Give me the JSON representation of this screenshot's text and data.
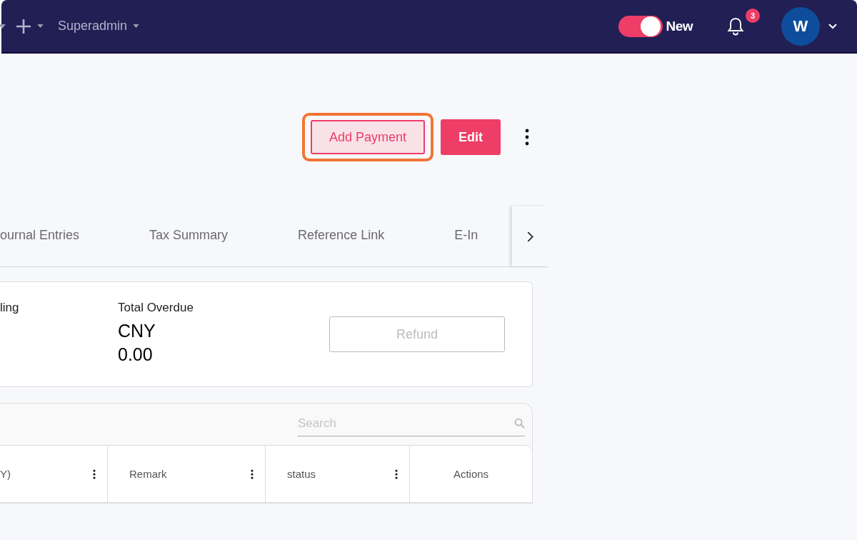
{
  "topbar": {
    "user_menu": {
      "label": "Superadmin"
    },
    "toggle": {
      "label": "New",
      "on": true
    },
    "notifications": {
      "count": "3"
    },
    "avatar": {
      "initial": "W"
    }
  },
  "actions": [
    {
      "label": "Add Payment",
      "kind": "secondary",
      "highlighted": true
    },
    {
      "label": "Edit",
      "kind": "primary",
      "highlighted": false
    }
  ],
  "tabs": [
    {
      "label": "ournal Entries",
      "selected": false
    },
    {
      "label": "Tax Summary",
      "selected": false
    },
    {
      "label": "Reference Link",
      "selected": false
    },
    {
      "label": "E-In",
      "selected": false
    }
  ],
  "summary": {
    "items": [
      {
        "label": "ling"
      },
      {
        "label": "Total Overdue",
        "currency": "CNY",
        "amount": "0.00"
      }
    ],
    "refund": {
      "label": "Refund",
      "disabled": true
    }
  },
  "table": {
    "search": {
      "placeholder": "Search"
    },
    "columns": [
      {
        "label": "Y)",
        "menu": true
      },
      {
        "label": "Remark",
        "menu": true
      },
      {
        "label": "status",
        "menu": true
      },
      {
        "label": "Actions",
        "menu": false
      }
    ]
  }
}
